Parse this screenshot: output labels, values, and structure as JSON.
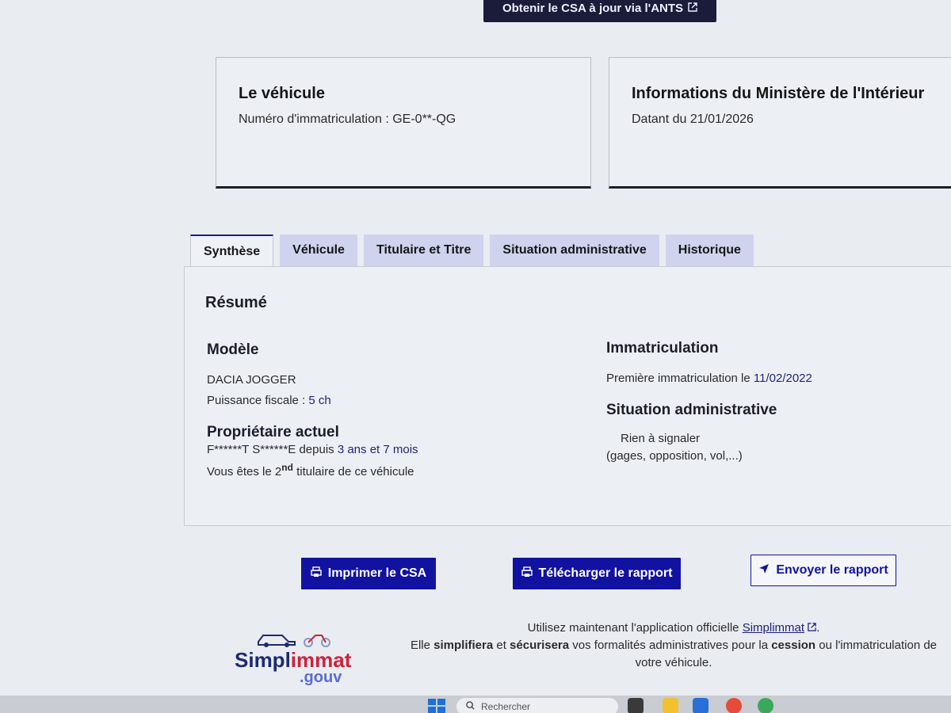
{
  "top_cta": {
    "label": "Obtenir le CSA à jour via l'ANTS",
    "icon": "external-link-icon"
  },
  "vehicle_card": {
    "title": "Le véhicule",
    "plate_label": "Numéro d'immatriculation : GE-0**-QG"
  },
  "ministry_card": {
    "title": "Informations du Ministère de l'Intérieur",
    "date_text": "Datant du 21/01/2026"
  },
  "tabs": [
    {
      "label": "Synthèse",
      "active": true
    },
    {
      "label": "Véhicule",
      "active": false
    },
    {
      "label": "Titulaire et Titre",
      "active": false
    },
    {
      "label": "Situation administrative",
      "active": false
    },
    {
      "label": "Historique",
      "active": false
    }
  ],
  "summary": {
    "title": "Résumé",
    "model": {
      "heading": "Modèle",
      "name": "DACIA JOGGER",
      "fiscal_label": "Puissance fiscale : ",
      "fiscal_value": "5 ch"
    },
    "owner": {
      "heading": "Propriétaire actuel",
      "name": "F******T S******E",
      "since_label": " depuis ",
      "since_value": "3 ans et 7 mois",
      "rank_prefix": "Vous êtes le 2",
      "rank_sup": "nd",
      "rank_suffix": " titulaire de ce véhicule"
    },
    "registration": {
      "heading": "Immatriculation",
      "first_label": "Première immatriculation le ",
      "first_date": "11/02/2022"
    },
    "admin": {
      "heading": "Situation administrative",
      "status": "Rien à signaler",
      "detail": "(gages, opposition, vol,...)"
    }
  },
  "actions": {
    "print": "Imprimer le CSA",
    "download": "Télécharger le rapport",
    "send": "Envoyer le rapport"
  },
  "promo": {
    "line1_prefix": "Utilisez maintenant l'application officielle ",
    "link": "Simplimmat",
    "line1_suffix": ".",
    "line2_a": "Elle ",
    "line2_b": "simplifiera",
    "line2_c": " et ",
    "line2_d": "sécurisera",
    "line2_e": " vos formalités administratives pour la ",
    "line2_f": "cession",
    "line2_g": " ou l'immatriculation de",
    "line3": "votre véhicule."
  },
  "logo": {
    "simpl": "Simpl",
    "immat": "immat",
    "gouv": ".gouv"
  },
  "taskbar": {
    "search_placeholder": "Rechercher"
  },
  "colors": {
    "primary": "#1212a0",
    "dark": "#1b1b3a",
    "tab_bg": "#cfd3ee"
  }
}
